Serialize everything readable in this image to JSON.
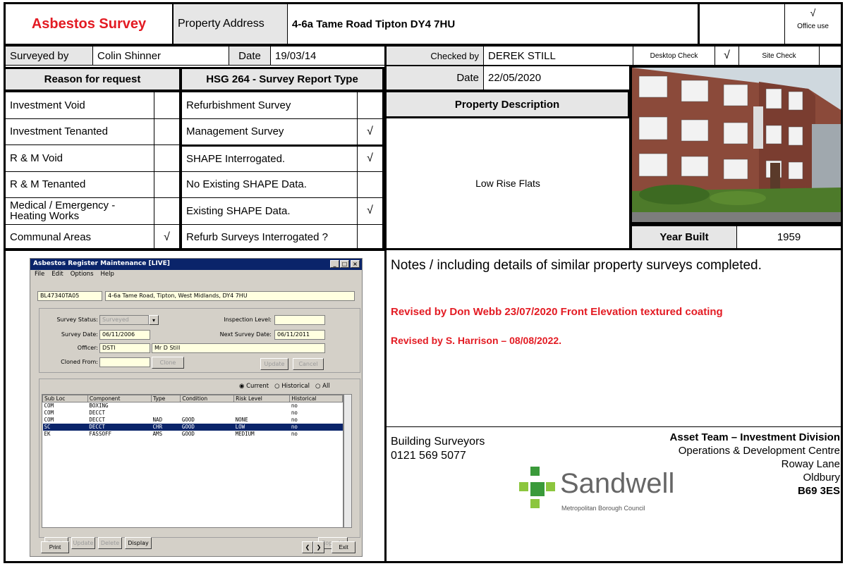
{
  "header": {
    "title": "Asbestos Survey",
    "address_label": "Property Address",
    "address_value": "4-6a Tame Road Tipton DY4 7HU",
    "office_tick": "√",
    "office_use": "Office use"
  },
  "survey_row": {
    "surveyed_by_label": "Surveyed by",
    "surveyed_by_value": "Colin Shinner",
    "date_label": "Date",
    "date_value": "19/03/14",
    "checked_by_label": "Checked by",
    "checked_by_value": "DEREK STILL",
    "desktop_check_label": "Desktop Check",
    "desktop_check_tick": "√",
    "site_check_label": "Site Check"
  },
  "reason": {
    "heading": "Reason for request",
    "items": [
      {
        "label": "Investment Void",
        "tick": ""
      },
      {
        "label": "Investment Tenanted",
        "tick": ""
      },
      {
        "label": "R & M Void",
        "tick": ""
      },
      {
        "label": "R & M Tenanted",
        "tick": ""
      },
      {
        "label": "Medical / Emergency - Heating Works",
        "tick": ""
      },
      {
        "label": "Communal Areas",
        "tick": "√"
      }
    ]
  },
  "report_type": {
    "heading": "HSG 264 - Survey Report Type",
    "items": [
      {
        "label": "Refurbishment Survey",
        "tick": ""
      },
      {
        "label": "Management Survey",
        "tick": "√"
      },
      {
        "label": "SHAPE Interrogated.",
        "tick": "√"
      },
      {
        "label": "No Existing SHAPE Data.",
        "tick": ""
      },
      {
        "label": "Existing SHAPE Data.",
        "tick": "√"
      },
      {
        "label": "Refurb Surveys Interrogated ?",
        "tick": ""
      }
    ]
  },
  "checked": {
    "date_label": "Date",
    "date_value": "22/05/2020",
    "description_heading": "Property Description",
    "description_value": "Low Rise Flats"
  },
  "year": {
    "label": "Year Built",
    "value": "1959"
  },
  "notes": {
    "heading_bold": "Notes",
    "heading_rest": " / including details of similar property surveys completed.",
    "revision1": "Revised by Don Webb 23/07/2020  Front Elevation textured coating",
    "revision2": "Revised by S. Harrison – 08/08/2022."
  },
  "footer": {
    "dept": "Building Surveyors",
    "phone": "0121 569 5077",
    "team": "Asset Team – Investment Division",
    "addr1": "Operations & Development Centre",
    "addr2": "Roway Lane",
    "addr3": "Oldbury",
    "postcode": "B69 3ES",
    "logo_name": "Sandwell",
    "logo_sub": "Metropolitan Borough Council"
  },
  "window": {
    "title": "Asbestos Register Maintenance [LIVE]",
    "menu": [
      "File",
      "Edit",
      "Options",
      "Help"
    ],
    "ref": "BL47340TA05",
    "address": "4-6a Tame Road, Tipton, West Midlands, DY4 7HU",
    "survey_status_label": "Survey Status:",
    "survey_status": "Surveyed",
    "inspection_level_label": "Inspection Level:",
    "survey_date_label": "Survey Date:",
    "survey_date": "06/11/2006",
    "next_survey_label": "Next Survey Date:",
    "next_survey": "06/11/2011",
    "officer_label": "Officer:",
    "officer_code": "DSTI",
    "officer_name": "Mr D Still",
    "cloned_label": "Cloned From:",
    "clone_btn": "Clone",
    "update_btn": "Update",
    "cancel_btn": "Cancel",
    "radio_current": "Current",
    "radio_historical": "Historical",
    "radio_all": "All",
    "columns": [
      "Sub Loc",
      "Component",
      "Type",
      "Condition",
      "Risk Level",
      "Historical"
    ],
    "rows": [
      [
        "COM",
        "BOXING",
        "",
        "",
        "",
        "no"
      ],
      [
        "COM",
        "DECCT",
        "",
        "",
        "",
        "no"
      ],
      [
        "COM",
        "DECCT",
        "NAD",
        "GOOD",
        "NONE",
        "no"
      ],
      [
        "SC",
        "DECCT",
        "CHR",
        "GOOD",
        "LOW",
        "no"
      ],
      [
        "EK",
        "FASSOFF",
        "AMS",
        "GOOD",
        "MEDIUM",
        "no"
      ]
    ],
    "create_btn": "Create",
    "update2_btn": "Update",
    "delete_btn": "Delete",
    "display_btn": "Display",
    "copy_all_btn": "Copy All",
    "print_btn": "Print",
    "exit_btn": "Exit"
  }
}
